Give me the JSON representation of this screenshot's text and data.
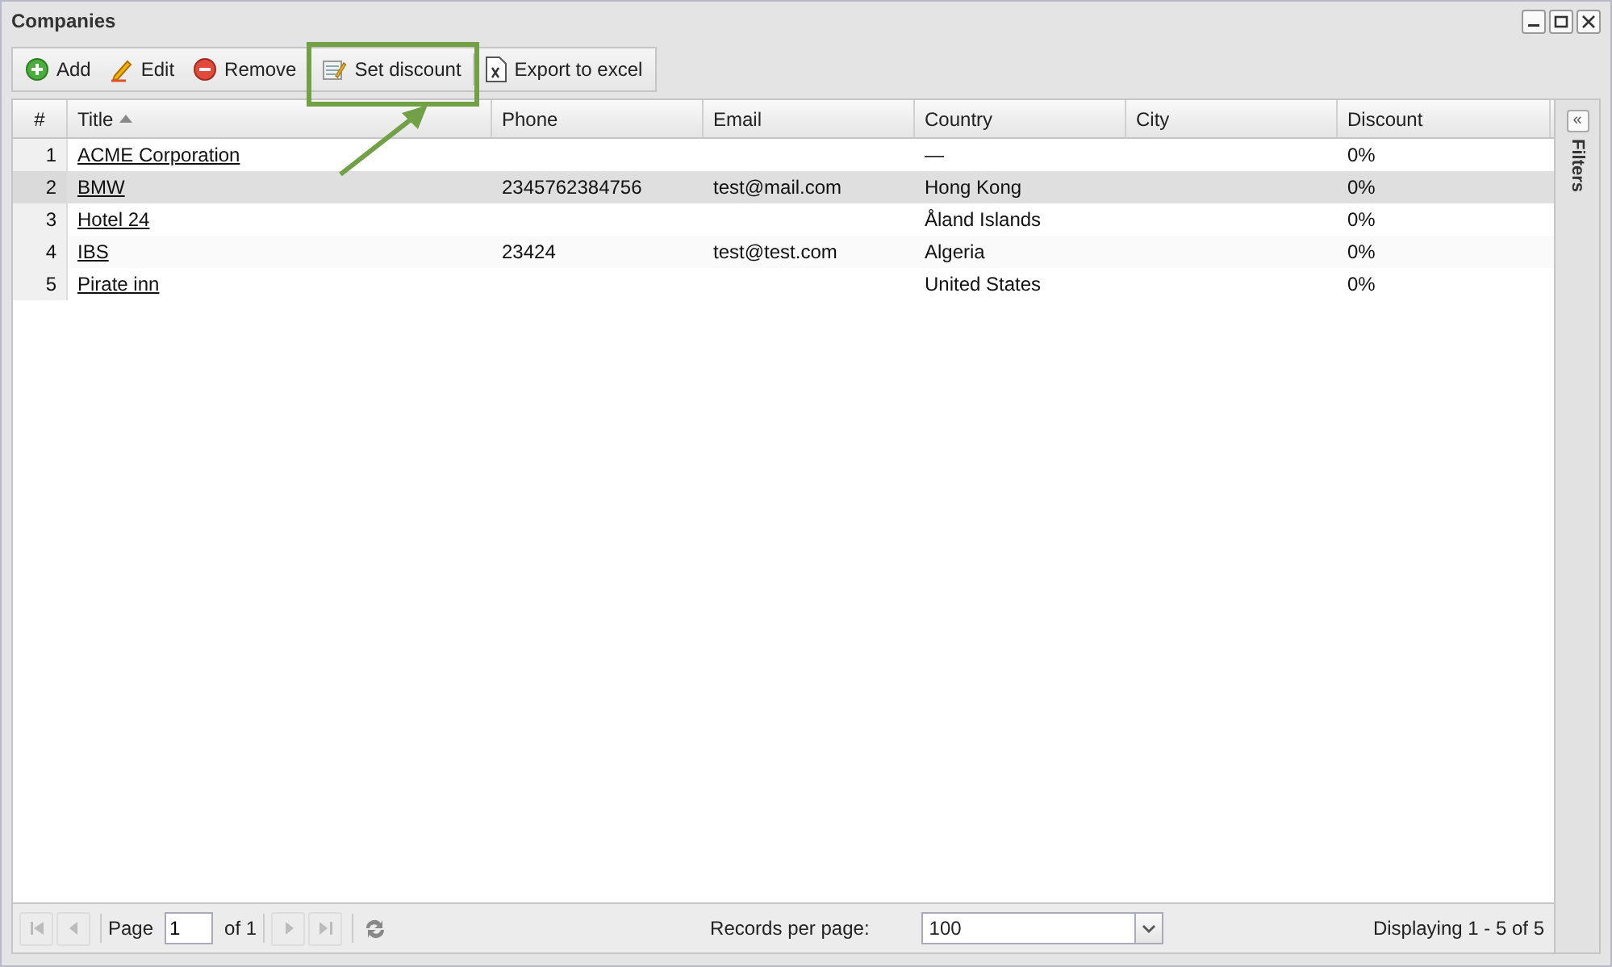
{
  "window": {
    "title": "Companies"
  },
  "toolbar": [
    {
      "kind": "add",
      "label": "Add"
    },
    {
      "kind": "edit",
      "label": "Edit"
    },
    {
      "kind": "remove",
      "label": "Remove"
    },
    {
      "kind": "discount",
      "label": "Set discount",
      "highlighted": true
    },
    {
      "kind": "excel",
      "label": "Export to excel"
    }
  ],
  "table": {
    "columns": [
      {
        "label": "#",
        "sorted": false
      },
      {
        "label": "Title",
        "sorted": true
      },
      {
        "label": "Phone",
        "sorted": false
      },
      {
        "label": "Email",
        "sorted": false
      },
      {
        "label": "Country",
        "sorted": false
      },
      {
        "label": "City",
        "sorted": false
      },
      {
        "label": "Discount",
        "sorted": false
      }
    ],
    "rows": [
      {
        "selected": false,
        "cells": [
          "1",
          "ACME Corporation",
          "",
          "",
          "—",
          "",
          "0%"
        ]
      },
      {
        "selected": true,
        "cells": [
          "2",
          "BMW",
          "2345762384756",
          "test@mail.com",
          "Hong Kong",
          "",
          "0%"
        ]
      },
      {
        "selected": false,
        "cells": [
          "3",
          "Hotel 24",
          "",
          "",
          "Åland Islands",
          "",
          "0%"
        ]
      },
      {
        "selected": false,
        "cells": [
          "4",
          "IBS",
          "23424",
          "test@test.com",
          "Algeria",
          "",
          "0%"
        ]
      },
      {
        "selected": false,
        "cells": [
          "5",
          "Pirate inn",
          "",
          "",
          "United States",
          "",
          "0%"
        ]
      }
    ]
  },
  "filters_panel": {
    "label": "Filters",
    "toggle": "«"
  },
  "paging": {
    "page_label": "Page",
    "page": "1",
    "of_label": "of 1",
    "records_label": "Records per page:",
    "records_value": "100",
    "summary": "Displaying 1 - 5 of 5"
  }
}
